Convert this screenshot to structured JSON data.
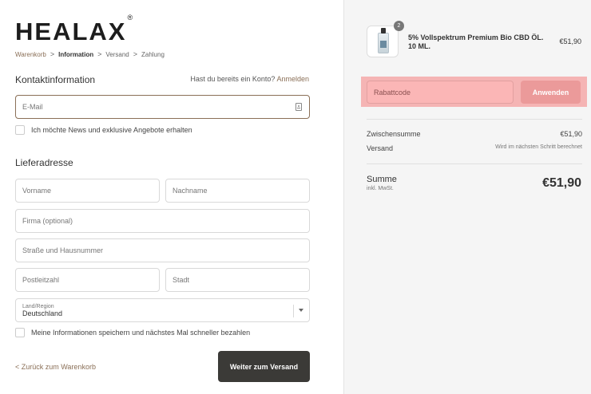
{
  "brand": {
    "logo": "HEALAX",
    "reg": "®"
  },
  "breadcrumb": {
    "items": [
      "Warenkorb",
      "Information",
      "Versand",
      "Zahlung"
    ],
    "separator": ">"
  },
  "contact": {
    "title": "Kontaktinformation",
    "login_prompt": "Hast du bereits ein Konto?",
    "login_link": "Anmelden",
    "email_placeholder": "E-Mail",
    "newsletter_label": "Ich möchte News und exklusive Angebote erhalten"
  },
  "shipping": {
    "title": "Lieferadresse",
    "first_name_placeholder": "Vorname",
    "last_name_placeholder": "Nachname",
    "company_placeholder": "Firma (optional)",
    "street_placeholder": "Straße und Hausnummer",
    "zip_placeholder": "Postleitzahl",
    "city_placeholder": "Stadt",
    "country_label": "Land/Region",
    "country_value": "Deutschland",
    "save_info_label": "Meine Informationen speichern und nächstes Mal schneller bezahlen"
  },
  "actions": {
    "back_label": "< Zurück zum Warenkorb",
    "continue_label": "Weiter zum Versand"
  },
  "summary": {
    "product": {
      "name": "5% Vollspektrum Premium Bio CBD ÖL. 10 ML.",
      "price": "€51,90",
      "quantity": "2"
    },
    "discount_placeholder": "Rabattcode",
    "apply_label": "Anwenden",
    "subtotal_label": "Zwischensumme",
    "subtotal_value": "€51,90",
    "shipping_label": "Versand",
    "shipping_value": "Wird im nächsten Schritt berechnet",
    "total_label": "Summe",
    "total_sub": "inkl. MwSt.",
    "total_value": "€51,90"
  },
  "colors": {
    "accent": "#8a6f57",
    "primary_button": "#3b3a37",
    "highlight": "#f5b4b4"
  }
}
